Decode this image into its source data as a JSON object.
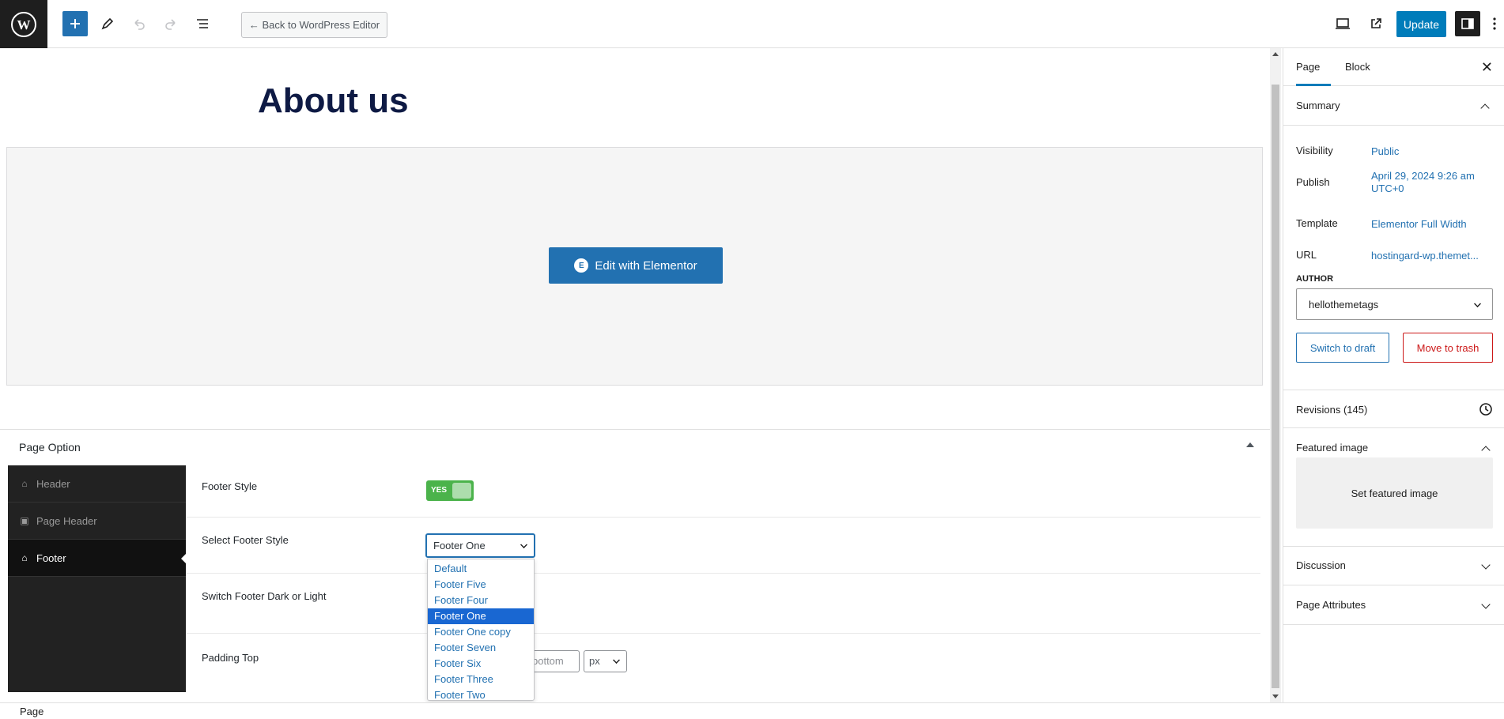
{
  "topbar": {
    "back_label": "← Back to WordPress Editor",
    "update_label": "Update"
  },
  "canvas": {
    "title": "About us",
    "elementor_button": "Edit with Elementor"
  },
  "page_option": {
    "title": "Page Option",
    "nav": [
      {
        "label": "Header",
        "icon": "home-icon"
      },
      {
        "label": "Page Header",
        "icon": "image-icon"
      },
      {
        "label": "Footer",
        "icon": "home-icon",
        "active": true
      }
    ],
    "footer_style_label": "Footer Style",
    "footer_style_toggle": "YES",
    "select_footer_label": "Select Footer Style",
    "select_footer_value": "Footer One",
    "dropdown_options": [
      "Default",
      "Footer Five",
      "Footer Four",
      "Footer One",
      "Footer One copy",
      "Footer Seven",
      "Footer Six",
      "Footer Three",
      "Footer Two"
    ],
    "selected_option": "Footer One",
    "switch_label": "Switch Footer Dark or Light",
    "padding_label": "Padding Top",
    "padding_bottom_placeholder": "bottom",
    "padding_unit": "px"
  },
  "sidebar": {
    "tabs": [
      "Page",
      "Block"
    ],
    "active_tab": "Page",
    "summary": "Summary",
    "visibility_label": "Visibility",
    "visibility_value": "Public",
    "publish_label": "Publish",
    "publish_value_line1": "April 29, 2024 9:26 am",
    "publish_value_line2": "UTC+0",
    "template_label": "Template",
    "template_value": "Elementor Full Width",
    "url_label": "URL",
    "url_value": "hostingard-wp.themet...",
    "author_label": "AUTHOR",
    "author_value": "hellothemetags",
    "switch_draft": "Switch to draft",
    "move_trash": "Move to trash",
    "revisions": "Revisions (145)",
    "featured_image": "Featured image",
    "set_featured": "Set featured image",
    "discussion": "Discussion",
    "page_attributes": "Page Attributes"
  },
  "statusbar": {
    "breadcrumb": "Page"
  },
  "colors": {
    "accent": "#2271b1",
    "toggle_on": "#4bb34b",
    "trash": "#cc1818",
    "title": "#0e1a44"
  }
}
